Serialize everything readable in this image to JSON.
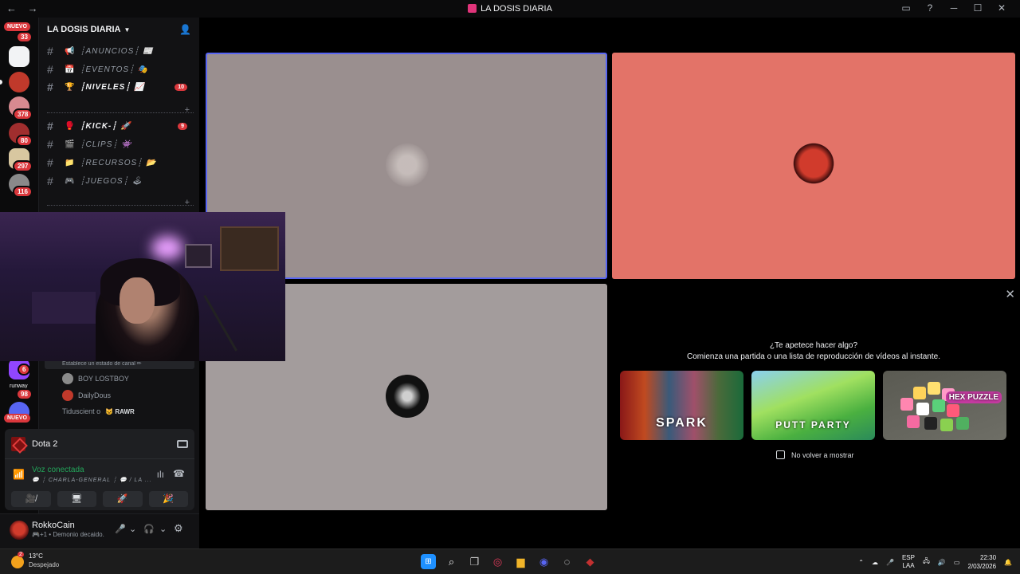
{
  "window": {
    "title": "LA DOSIS DIARIA",
    "back_glyph": "←",
    "fwd_glyph": "→",
    "controls": [
      "▭",
      "?",
      "─",
      "☐",
      "✕"
    ]
  },
  "guilds": {
    "nuevo_top": "NUEVO",
    "nuevo_bottom": "NUEVO",
    "badges": [
      "33",
      "378",
      "80",
      "297",
      "116",
      "6",
      "98"
    ],
    "runway_label": "runway"
  },
  "server": {
    "name": "LA DOSIS DIARIA",
    "channels": [
      {
        "emoji": "📢",
        "label": "┊ANUNCIOS┊ 📰",
        "unread": false,
        "count": ""
      },
      {
        "emoji": "📅",
        "label": "┊EVENTOS┊ 🎭",
        "unread": false,
        "count": ""
      },
      {
        "emoji": "🏆",
        "label": "┊NIVELES┊ 📈",
        "unread": true,
        "count": "10"
      },
      {
        "emoji": "🥊",
        "label": "┊KICK-┊ 🚀",
        "unread": true,
        "count": "9"
      },
      {
        "emoji": "🎬",
        "label": "┊CLIPS┊ 👾",
        "unread": false,
        "count": ""
      },
      {
        "emoji": "📁",
        "label": "┊RECURSOS┊ 📂",
        "unread": false,
        "count": ""
      },
      {
        "emoji": "🎮",
        "label": "┊JUEGOS┊ 🕹",
        "unread": false,
        "count": ""
      }
    ],
    "status_hint": "Establece un estado de canal ✏",
    "members": [
      {
        "name": "BOY LOSTBOY",
        "tag": "",
        "color": "#8a8a8a"
      },
      {
        "name": "DailyDous",
        "tag": "",
        "color": "#c0392b"
      },
      {
        "name": "Tiduscient o",
        "tag": "😺 RAWR",
        "color": "#9a9a9a"
      }
    ]
  },
  "voice": {
    "activity_name": "Dota 2",
    "state": "Voz conectada",
    "where": "💬 ┊ CHARLA-GENERAL ┊ 💬 / LA ...",
    "buttons": [
      "🎥̸",
      "🖥",
      "🚀",
      "🎉"
    ]
  },
  "user": {
    "name": "RokkoCain",
    "status": "🎮+1 • Demonio decaido.",
    "controls": [
      "🎤",
      "⌄",
      "🎧",
      "⌄",
      "⚙"
    ]
  },
  "activities": {
    "question": "¿Te apetece hacer algo?",
    "subtitle": "Comienza una partida o una lista de reproducción de vídeos al instante.",
    "cards": [
      "SPARK",
      "PUTT PARTY",
      "HEX PUZZLE"
    ],
    "dont_show": "No volver a mostrar",
    "close_glyph": "✕"
  },
  "taskbar": {
    "temp": "13°C",
    "weather": "Despejado",
    "weather_badge": "2",
    "lang1": "ESP",
    "lang2": "LAA",
    "time": "22:30",
    "date": "2/03/2026"
  }
}
